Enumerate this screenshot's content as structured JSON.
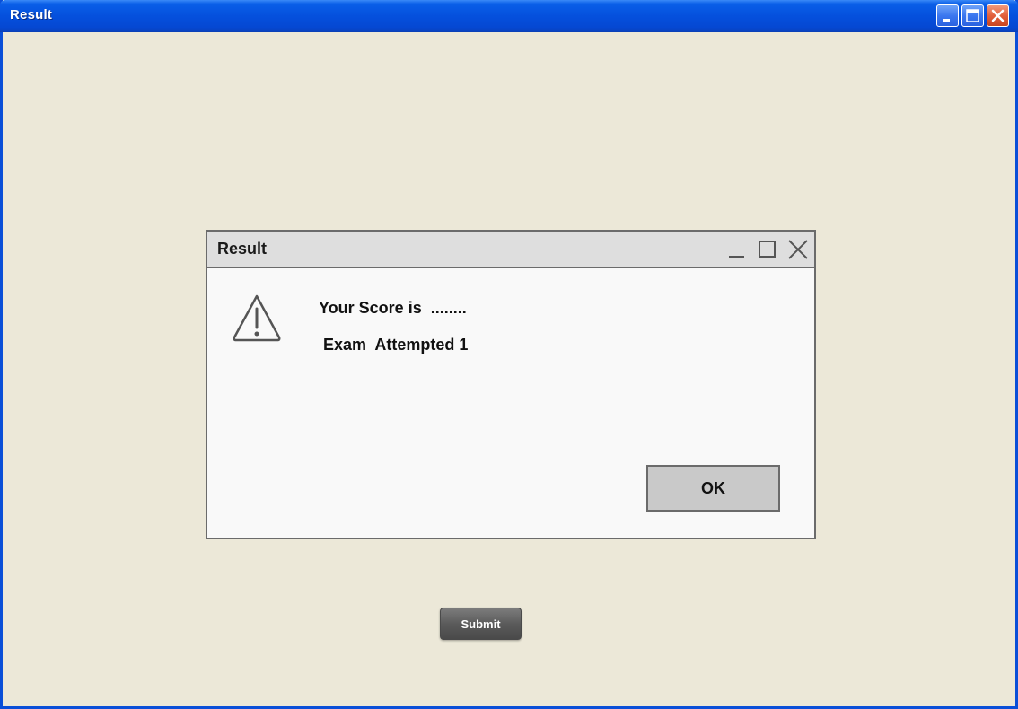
{
  "window": {
    "title": "Result",
    "controls": [
      "minimize-icon",
      "maximize-icon",
      "close-icon"
    ]
  },
  "dialog": {
    "title": "Result",
    "controls": [
      "minimize-icon",
      "maximize-icon",
      "close-icon"
    ],
    "icon": "warning-icon",
    "score_text": "Your Score is  ........",
    "attempt_text": "Exam  Attempted 1",
    "ok_label": "OK"
  },
  "main": {
    "submit_label": "Submit"
  },
  "colors": {
    "titlebar_blue": "#0550dd",
    "window_bg": "#ece8d8",
    "dialog_bg": "#f9f9f9",
    "close_button": "#e2603c"
  }
}
